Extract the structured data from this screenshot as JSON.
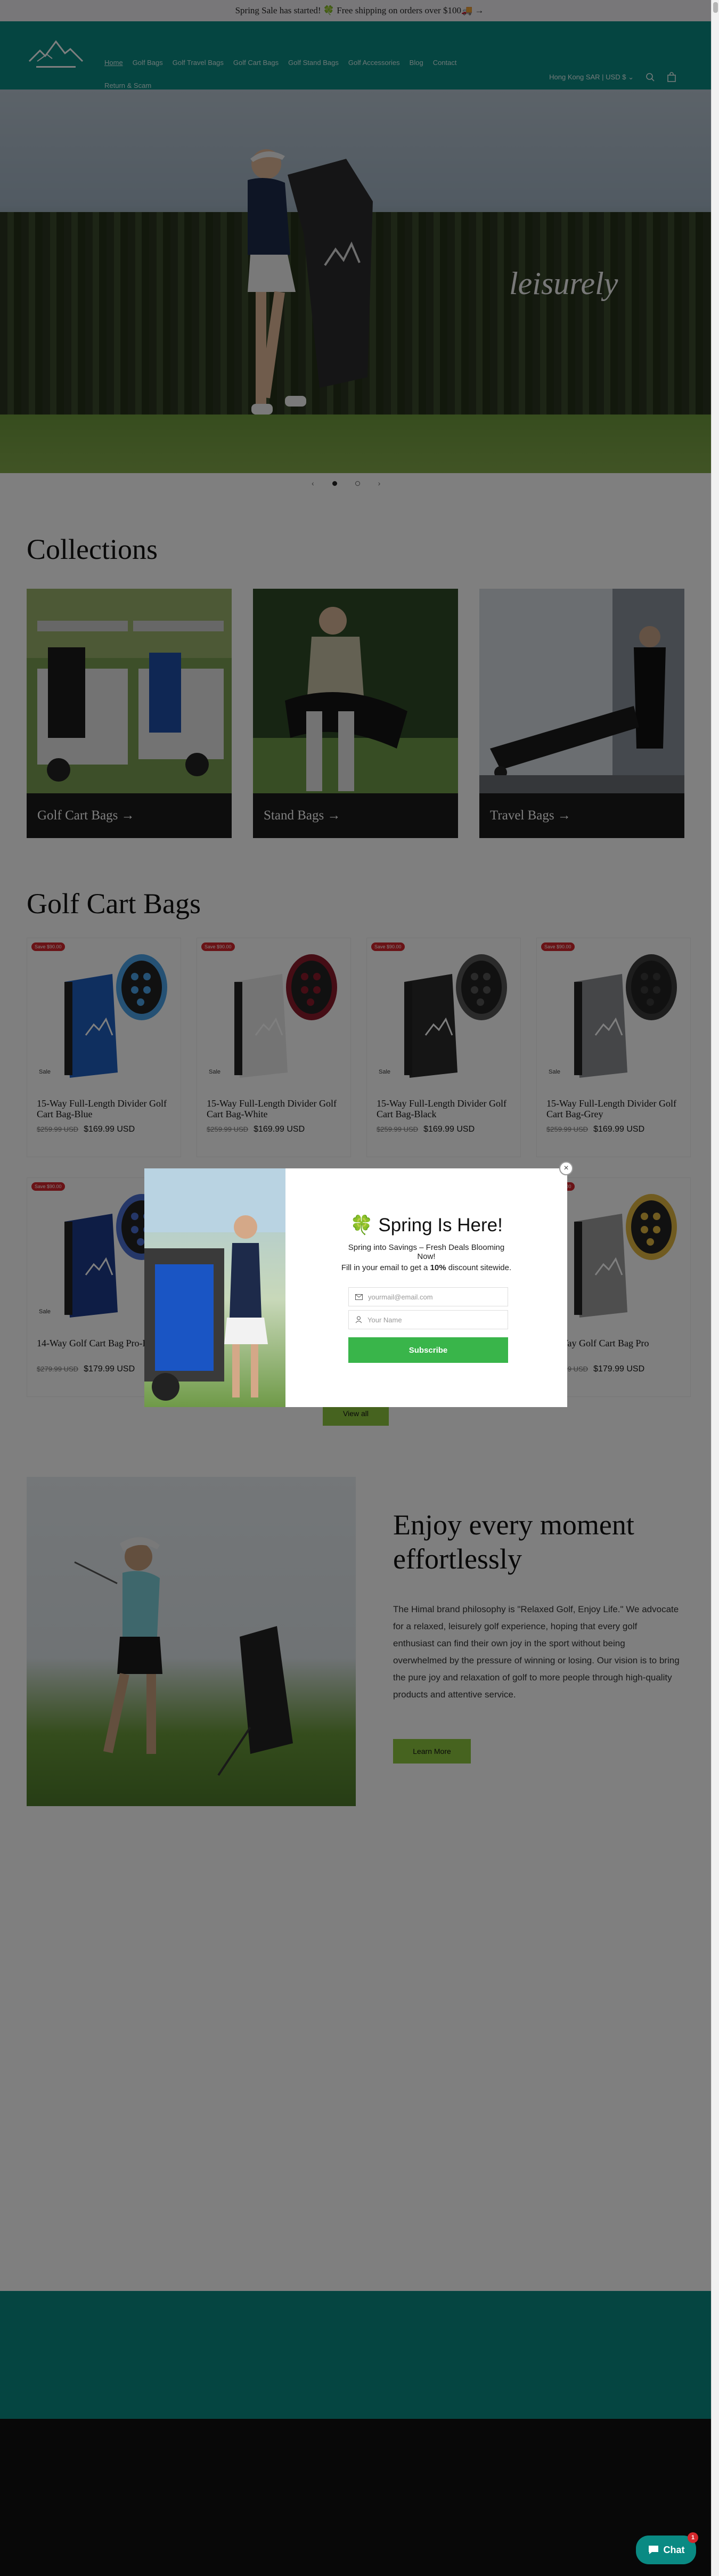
{
  "announcement": "Spring Sale has started! 🍀 Free shipping on orders over $100🚚 →",
  "header": {
    "nav": [
      {
        "label": "Home"
      },
      {
        "label": "Golf Bags"
      },
      {
        "label": "Golf Travel Bags"
      },
      {
        "label": "Golf Cart Bags"
      },
      {
        "label": "Golf Stand Bags"
      },
      {
        "label": "Golf Accessories"
      },
      {
        "label": "Blog"
      },
      {
        "label": "Contact"
      },
      {
        "label": "Return & Scam"
      }
    ],
    "currency": "Hong Kong SAR | USD $"
  },
  "hero": {
    "text": "leisurely"
  },
  "collections": {
    "title": "Collections",
    "items": [
      {
        "label": "Golf Cart Bags →"
      },
      {
        "label": "Stand Bags →"
      },
      {
        "label": "Travel Bags →"
      }
    ]
  },
  "products": {
    "title": "Golf Cart Bags",
    "badge": "Save $90.00",
    "sale_label": "Sale",
    "items": [
      {
        "title": "15-Way Full-Length Divider Golf Cart Bag-Blue",
        "old": "$259.99 USD",
        "price": "$169.99 USD",
        "color": "#1f5fbf",
        "accent": "#4aa3e8"
      },
      {
        "title": "15-Way Full-Length Divider Golf Cart Bag-White",
        "old": "$259.99 USD",
        "price": "$169.99 USD",
        "color": "#e8e8e8",
        "accent": "#8a1a2a"
      },
      {
        "title": "15-Way Full-Length Divider Golf Cart Bag-Black",
        "old": "$259.99 USD",
        "price": "$169.99 USD",
        "color": "#2a2a2a",
        "accent": "#555555"
      },
      {
        "title": "15-Way Full-Length Divider Golf Cart Bag-Grey",
        "old": "$259.99 USD",
        "price": "$169.99 USD",
        "color": "#8a8d91",
        "accent": "#3a3a3a"
      },
      {
        "title": "14-Way Golf Cart Bag Pro-Blue",
        "old": "$279.99 USD",
        "price": "$179.99 USD",
        "color": "#1c3a8a",
        "accent": "#4a6ed0"
      },
      {
        "title": "14-Way Golf Cart Bag Pro",
        "old": "$279.99 USD",
        "price": "$179.99 USD",
        "color": "#9c9c9c",
        "accent": "#e0b640"
      }
    ],
    "view_all": "View all"
  },
  "enjoy": {
    "title": "Enjoy every moment effortlessly",
    "body": "The Himal brand philosophy is \"Relaxed Golf, Enjoy Life.\" We advocate for a relaxed, leisurely golf experience, hoping that every golf enthusiast can find their own joy in the sport without being overwhelmed by the pressure of winning or losing. Our vision is to bring the pure joy and relaxation of golf to more people through high-quality products and attentive service.",
    "button": "Learn More"
  },
  "popup": {
    "title": "🍀 Spring Is Here!",
    "subtitle": "Spring into Savings – Fresh Deals Blooming Now!",
    "desc_prefix": "Fill in your email to get a ",
    "desc_bold": "10%",
    "desc_suffix": " discount sitewide.",
    "email_placeholder": "yourmail@email.com",
    "name_placeholder": "Your Name",
    "submit": "Subscribe"
  },
  "chat": {
    "label": "Chat",
    "count": "1"
  }
}
